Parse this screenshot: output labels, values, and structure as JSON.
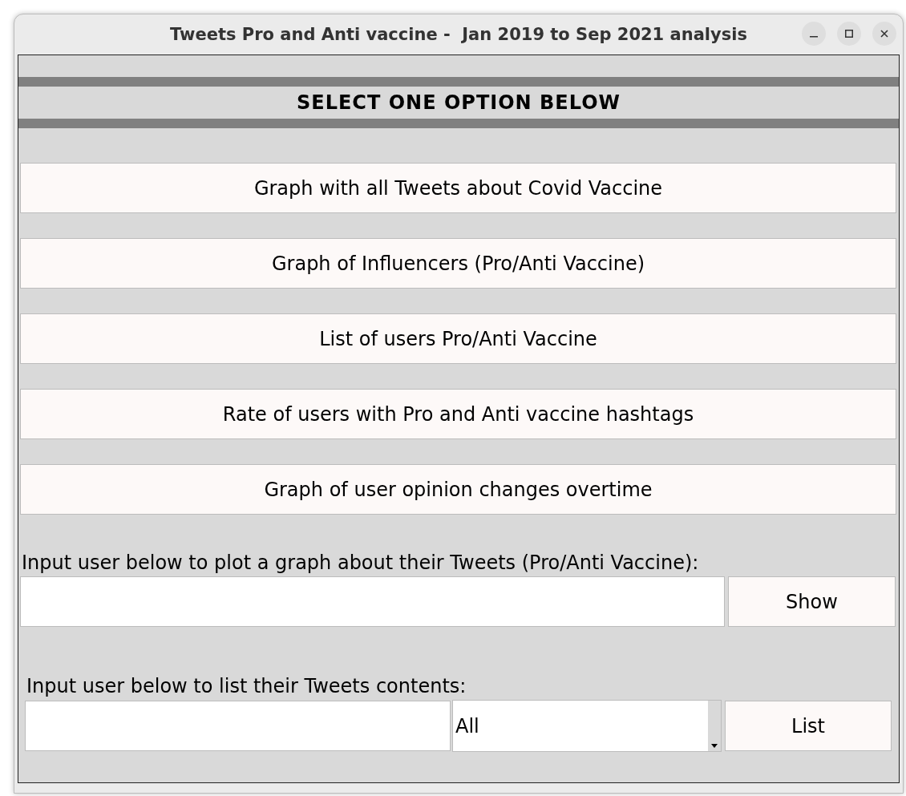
{
  "window": {
    "title": "Tweets Pro and Anti vaccine -  Jan 2019 to Sep 2021 analysis"
  },
  "heading": "SELECT ONE OPTION BELOW",
  "options": [
    "Graph with all Tweets about Covid Vaccine",
    "Graph of Influencers (Pro/Anti Vaccine)",
    "List of users Pro/Anti Vaccine",
    "Rate of users with Pro and Anti vaccine hashtags",
    "Graph of user opinion changes overtime"
  ],
  "plot_user": {
    "label": "Input user below to plot a graph about their Tweets (Pro/Anti Vaccine):",
    "button": "Show"
  },
  "list_user": {
    "label": "Input user below to list their Tweets contents:",
    "filter": "All",
    "button": "List"
  }
}
